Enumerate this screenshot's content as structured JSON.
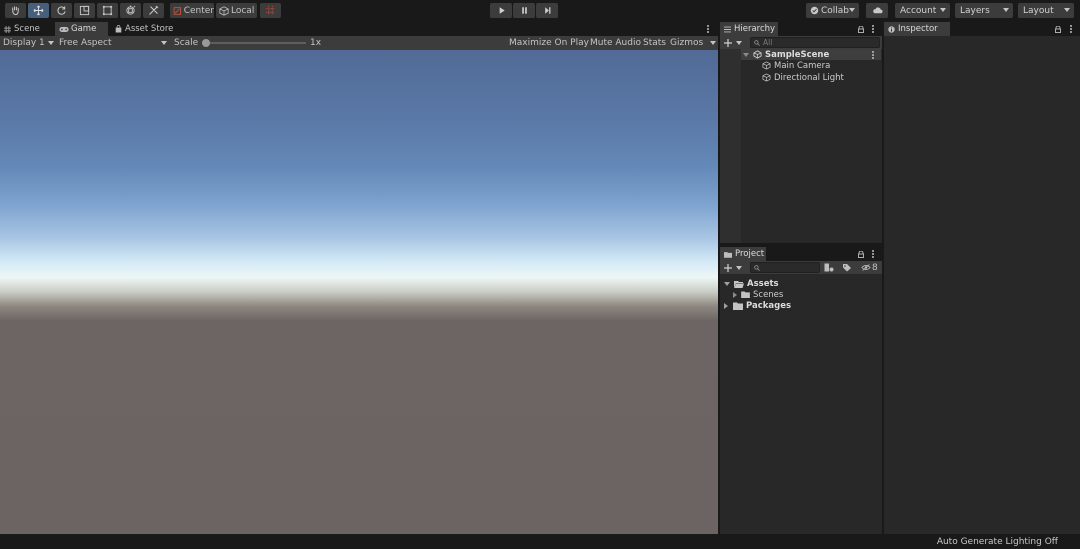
{
  "toolbar": {
    "pivot_label": "Center",
    "space_label": "Local",
    "collab_label": "Collab",
    "account_label": "Account",
    "layers_label": "Layers",
    "layout_label": "Layout"
  },
  "scene_tabs": {
    "scene": "Scene",
    "game": "Game",
    "asset_store": "Asset Store"
  },
  "game_toolbar": {
    "display": "Display 1",
    "aspect": "Free Aspect",
    "scale_label": "Scale",
    "scale_value": "1x",
    "scale_fraction": 0.0,
    "maximize": "Maximize On Play",
    "mute": "Mute Audio",
    "stats": "Stats",
    "gizmos": "Gizmos"
  },
  "hierarchy": {
    "title": "Hierarchy",
    "search_placeholder": "All",
    "scene_name": "SampleScene",
    "items": [
      "Main Camera",
      "Directional Light"
    ]
  },
  "project": {
    "title": "Project",
    "search_placeholder": "",
    "hidden_count": "8",
    "assets": "Assets",
    "scenes": "Scenes",
    "packages": "Packages"
  },
  "inspector": {
    "title": "Inspector"
  },
  "status": {
    "lighting": "Auto Generate Lighting Off"
  },
  "colors": {
    "toolbar_bg": "#191919",
    "panel_bg": "#282828",
    "button_bg": "#3c3c3c",
    "active_tool": "#46607c",
    "sky_top": "#516a96",
    "horizon": "#eef6f6",
    "ground": "#6b6462"
  }
}
